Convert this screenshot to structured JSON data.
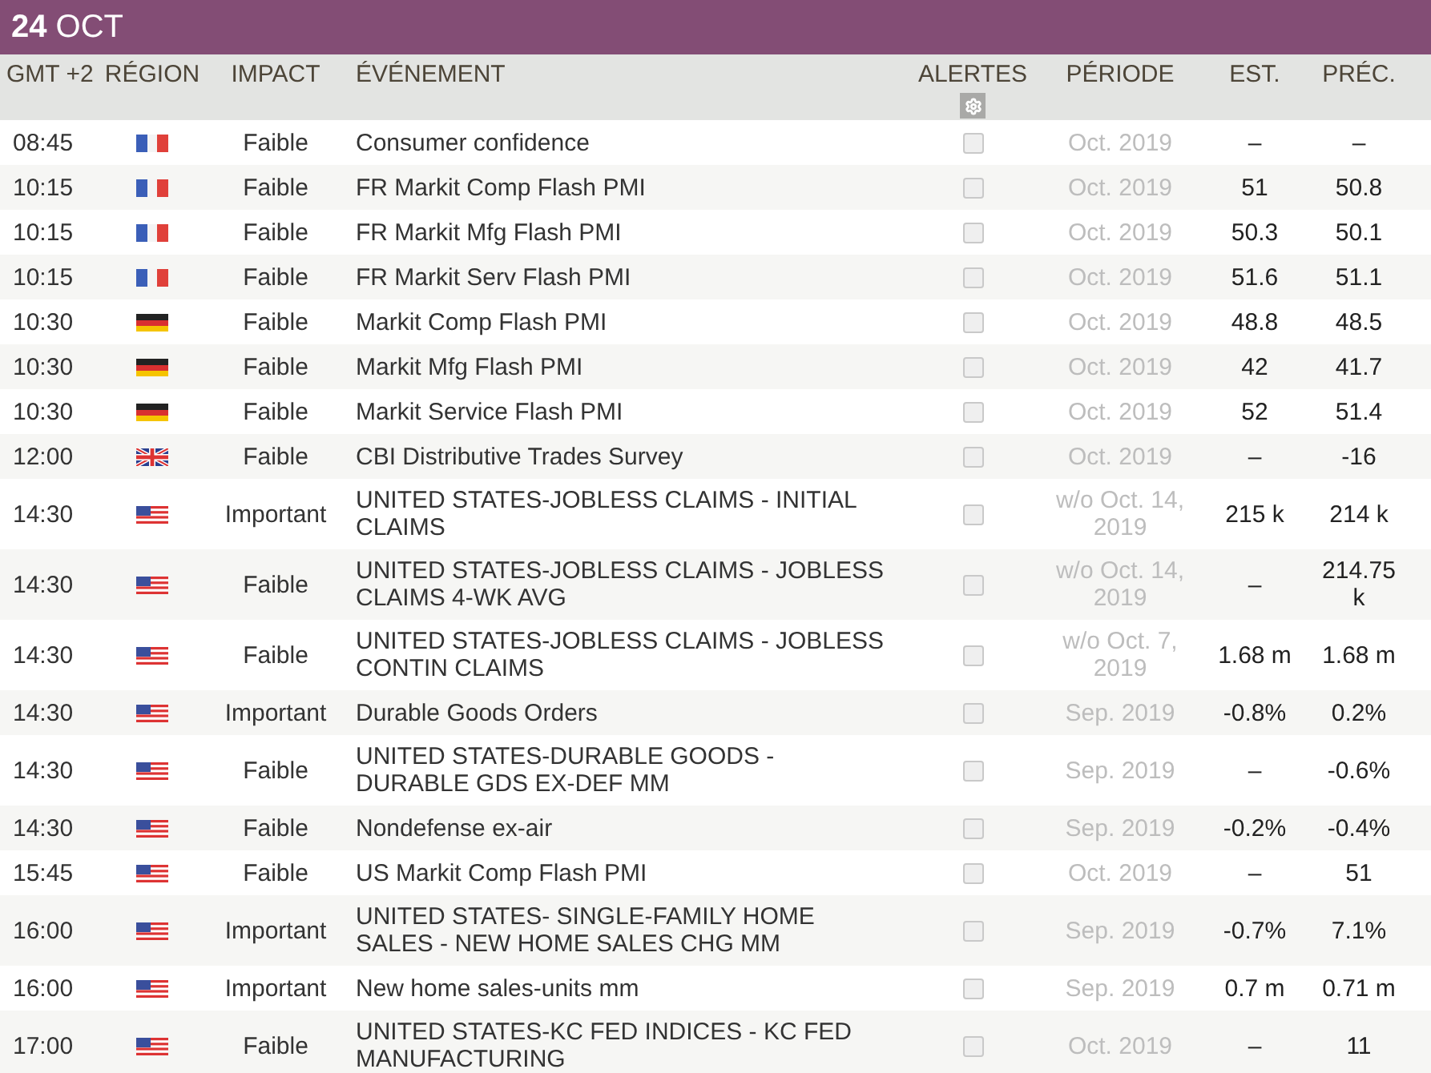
{
  "header": {
    "title": "**24** OCT"
  },
  "columns": {
    "time": "GMT +2",
    "region": "RÉGION",
    "impact": "IMPACT",
    "event": "ÉVÉNEMENT",
    "alerts": "ALERTES",
    "period": "PÉRIODE",
    "est": "EST.",
    "prev": "PRÉC."
  },
  "rows": [
    {
      "time": "08:45",
      "kind": "fr",
      "impact": "Faible",
      "event": "Consumer confidence",
      "alert_checked": false,
      "period": "Oct. 2019",
      "est": "–",
      "prev": "–"
    },
    {
      "time": "10:15",
      "kind": "fr",
      "impact": "Faible",
      "event": "FR Markit Comp Flash PMI",
      "alert_checked": false,
      "period": "Oct. 2019",
      "est": "51",
      "prev": "50.8"
    },
    {
      "time": "10:15",
      "kind": "fr",
      "impact": "Faible",
      "event": "FR Markit Mfg Flash PMI",
      "alert_checked": false,
      "period": "Oct. 2019",
      "est": "50.3",
      "prev": "50.1"
    },
    {
      "time": "10:15",
      "kind": "fr",
      "impact": "Faible",
      "event": "FR Markit Serv Flash PMI",
      "alert_checked": false,
      "period": "Oct. 2019",
      "est": "51.6",
      "prev": "51.1"
    },
    {
      "time": "10:30",
      "kind": "de",
      "impact": "Faible",
      "event": "Markit Comp Flash PMI",
      "alert_checked": false,
      "period": "Oct. 2019",
      "est": "48.8",
      "prev": "48.5"
    },
    {
      "time": "10:30",
      "kind": "de",
      "impact": "Faible",
      "event": "Markit Mfg Flash PMI",
      "alert_checked": false,
      "period": "Oct. 2019",
      "est": "42",
      "prev": "41.7"
    },
    {
      "time": "10:30",
      "kind": "de",
      "impact": "Faible",
      "event": "Markit Service Flash PMI",
      "alert_checked": false,
      "period": "Oct. 2019",
      "est": "52",
      "prev": "51.4"
    },
    {
      "time": "12:00",
      "kind": "uk",
      "impact": "Faible",
      "event": "CBI Distributive Trades Survey",
      "alert_checked": false,
      "period": "Oct. 2019",
      "est": "–",
      "prev": "-16"
    },
    {
      "time": "14:30",
      "kind": "us",
      "impact": "Important",
      "event": "UNITED STATES-JOBLESS CLAIMS - INITIAL CLAIMS",
      "alert_checked": false,
      "period": "w/o Oct. 14, 2019",
      "est": "215 k",
      "prev": "214 k"
    },
    {
      "time": "14:30",
      "kind": "us",
      "impact": "Faible",
      "event": "UNITED STATES-JOBLESS CLAIMS - JOBLESS CLAIMS 4-WK AVG",
      "alert_checked": false,
      "period": "w/o Oct. 14, 2019",
      "est": "–",
      "prev": "214.75 k"
    },
    {
      "time": "14:30",
      "kind": "us",
      "impact": "Faible",
      "event": "UNITED STATES-JOBLESS CLAIMS - JOBLESS CONTIN CLAIMS",
      "alert_checked": false,
      "period": "w/o Oct. 7, 2019",
      "est": "1.68 m",
      "prev": "1.68 m"
    },
    {
      "time": "14:30",
      "kind": "us",
      "impact": "Important",
      "event": "Durable Goods Orders",
      "alert_checked": false,
      "period": "Sep. 2019",
      "est": "-0.8%",
      "prev": "0.2%"
    },
    {
      "time": "14:30",
      "kind": "us",
      "impact": "Faible",
      "event": "UNITED STATES-DURABLE GOODS - DURABLE GDS EX-DEF MM",
      "alert_checked": false,
      "period": "Sep. 2019",
      "est": "–",
      "prev": "-0.6%"
    },
    {
      "time": "14:30",
      "kind": "us",
      "impact": "Faible",
      "event": "Nondefense ex-air",
      "alert_checked": false,
      "period": "Sep. 2019",
      "est": "-0.2%",
      "prev": "-0.4%"
    },
    {
      "time": "15:45",
      "kind": "us",
      "impact": "Faible",
      "event": "US Markit Comp Flash PMI",
      "alert_checked": false,
      "period": "Oct. 2019",
      "est": "–",
      "prev": "51"
    },
    {
      "time": "16:00",
      "kind": "us",
      "impact": "Important",
      "event": "UNITED STATES- SINGLE-FAMILY HOME SALES - NEW HOME SALES CHG MM",
      "alert_checked": false,
      "period": "Sep. 2019",
      "est": "-0.7%",
      "prev": "7.1%"
    },
    {
      "time": "16:00",
      "kind": "us",
      "impact": "Important",
      "event": "New home sales-units mm",
      "alert_checked": false,
      "period": "Sep. 2019",
      "est": "0.7 m",
      "prev": "0.71 m"
    },
    {
      "time": "17:00",
      "kind": "us",
      "impact": "Faible",
      "event": "UNITED STATES-KC FED INDICES - KC FED MANUFACTURING",
      "alert_checked": false,
      "period": "Oct. 2019",
      "est": "–",
      "prev": "11"
    }
  ]
}
